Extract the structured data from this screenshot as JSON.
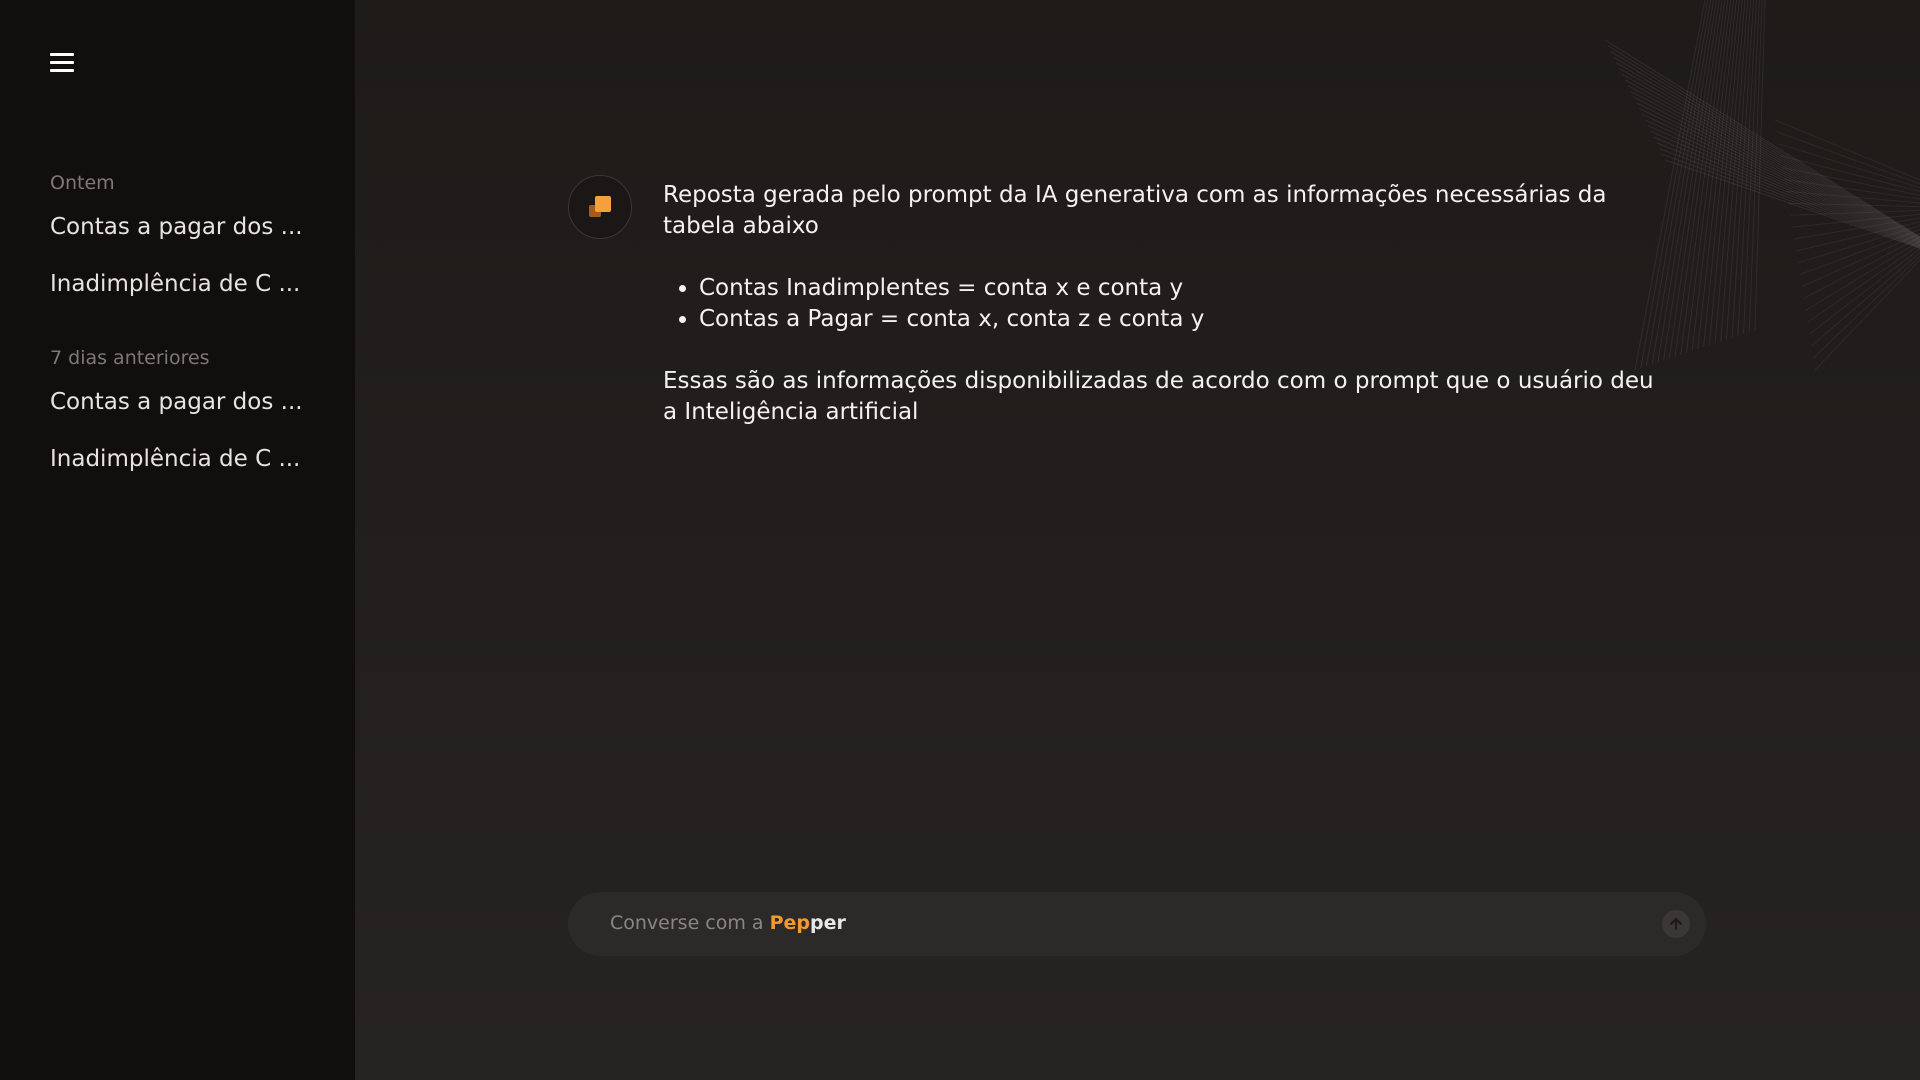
{
  "sidebar": {
    "menu_icon": "hamburger-menu-icon",
    "sections": [
      {
        "label": "Ontem",
        "items": [
          "Contas a pagar dos ...",
          "Inadimplência de C ..."
        ]
      },
      {
        "label": "7 dias anteriores",
        "items": [
          "Contas a pagar dos ...",
          "Inadimplência de C ..."
        ]
      }
    ]
  },
  "chat": {
    "assistant_icon": "pepper-logo-icon",
    "message": {
      "intro": "Reposta gerada pelo prompt da IA generativa com as informações necessárias da tabela abaixo",
      "bullets": [
        "Contas Inadimplentes = conta x e conta y",
        "Contas a Pagar = conta x, conta z e conta y"
      ],
      "outro": "Essas são as informações disponibilizadas de acordo com o prompt que o usuário deu a Inteligência artificial"
    }
  },
  "input": {
    "placeholder_prefix": "Converse com a ",
    "brand_part1": "Pep",
    "brand_part2": "per",
    "send_icon": "send-arrow-icon"
  },
  "colors": {
    "accent": "#f29a2e",
    "sidebar_bg": "#110f0e",
    "main_bg": "#1e1b19"
  }
}
